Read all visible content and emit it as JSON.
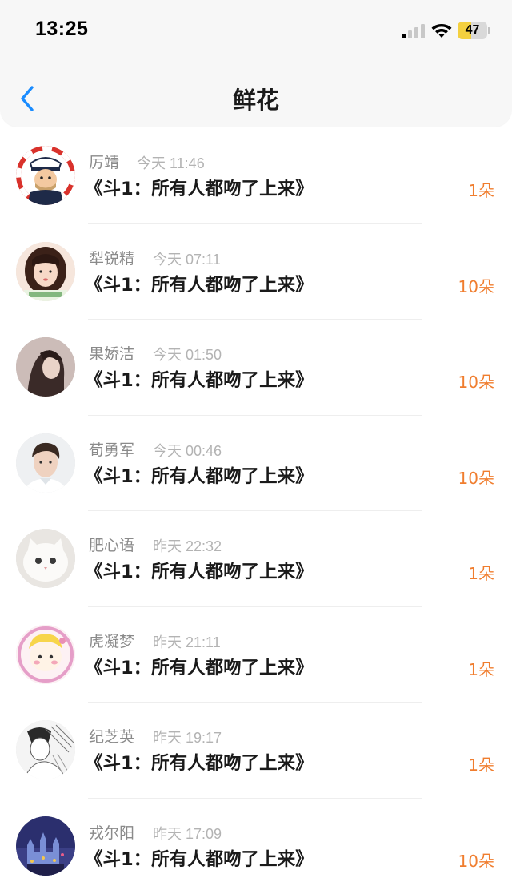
{
  "status_bar": {
    "time": "13:25",
    "battery_level": "47",
    "battery_fraction": 0.47,
    "battery_color": "#f4d03f"
  },
  "nav": {
    "back_icon": "chevron-left-icon",
    "title": "鲜花"
  },
  "colors": {
    "accent": "#1a8cff",
    "flower_count": "#f07d2e",
    "name_gray": "#8a8a8a",
    "time_gray": "#b3b3b3"
  },
  "items": [
    {
      "name": "厉靖",
      "time": "今天 11:46",
      "book": "《斗1：所有人都吻了上来》",
      "flowers": "1朵",
      "avatar": "cartoon-captain-avatar"
    },
    {
      "name": "犁锐精",
      "time": "今天 07:11",
      "book": "《斗1：所有人都吻了上来》",
      "flowers": "10朵",
      "avatar": "girl-avatar"
    },
    {
      "name": "果娇洁",
      "time": "今天 01:50",
      "book": "《斗1：所有人都吻了上来》",
      "flowers": "10朵",
      "avatar": "girl-profile-avatar"
    },
    {
      "name": "荀勇军",
      "time": "今天 00:46",
      "book": "《斗1：所有人都吻了上来》",
      "flowers": "10朵",
      "avatar": "boy-avatar"
    },
    {
      "name": "肥心语",
      "time": "昨天 22:32",
      "book": "《斗1：所有人都吻了上来》",
      "flowers": "1朵",
      "avatar": "white-cat-avatar"
    },
    {
      "name": "虎凝梦",
      "time": "昨天 21:11",
      "book": "《斗1：所有人都吻了上来》",
      "flowers": "1朵",
      "avatar": "cartoon-pink-avatar"
    },
    {
      "name": "纪芝英",
      "time": "昨天 19:17",
      "book": "《斗1：所有人都吻了上来》",
      "flowers": "1朵",
      "avatar": "manga-sketch-avatar"
    },
    {
      "name": "戎尔阳",
      "time": "昨天 17:09",
      "book": "《斗1：所有人都吻了上来》",
      "flowers": "10朵",
      "avatar": "castle-night-avatar"
    }
  ]
}
